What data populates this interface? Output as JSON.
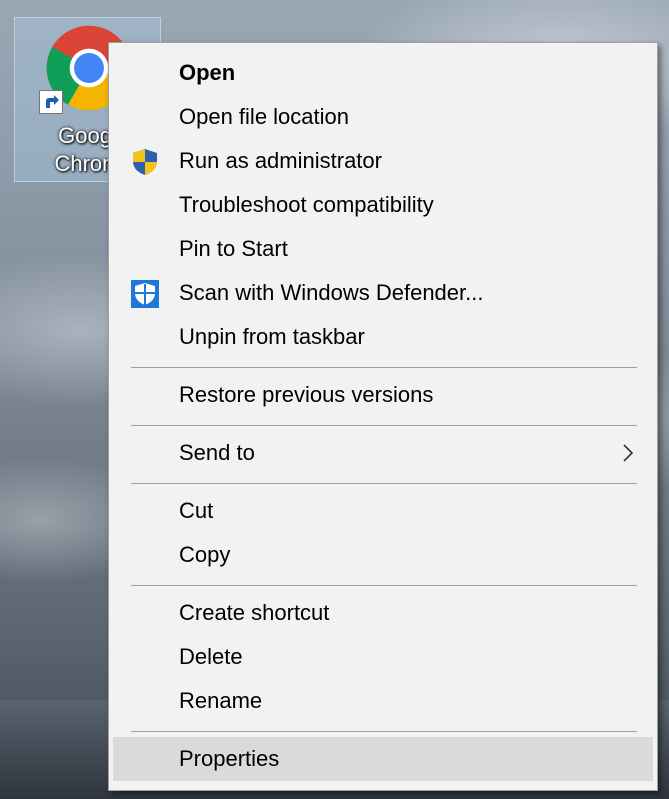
{
  "desktop_icon": {
    "label_line1": "Googl",
    "label_line2": "Chrom"
  },
  "menu": {
    "items": [
      {
        "label": "Open",
        "bold": true,
        "icon": null
      },
      {
        "label": "Open file location",
        "icon": null
      },
      {
        "label": "Run as administrator",
        "icon": "uac-shield-icon"
      },
      {
        "label": "Troubleshoot compatibility",
        "icon": null
      },
      {
        "label": "Pin to Start",
        "icon": null
      },
      {
        "label": "Scan with Windows Defender...",
        "icon": "windows-defender-icon"
      },
      {
        "label": "Unpin from taskbar",
        "icon": null
      },
      {
        "label": "Restore previous versions",
        "icon": null
      },
      {
        "label": "Send to",
        "icon": null,
        "submenu": true
      },
      {
        "label": "Cut",
        "icon": null
      },
      {
        "label": "Copy",
        "icon": null
      },
      {
        "label": "Create shortcut",
        "icon": null
      },
      {
        "label": "Delete",
        "icon": null
      },
      {
        "label": "Rename",
        "icon": null
      },
      {
        "label": "Properties",
        "icon": null,
        "highlighted": true
      }
    ]
  },
  "colors": {
    "menu_bg": "#f2f2f2",
    "highlight": "#dadada",
    "separator": "#a0a0a0",
    "defender_blue": "#1e78d7",
    "uac_blue": "#2d5fb0",
    "uac_yellow": "#f3c21b"
  }
}
